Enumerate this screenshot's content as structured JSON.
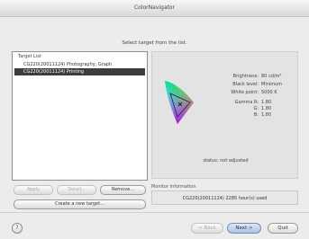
{
  "window": {
    "title": "ColorNavigator"
  },
  "instruction": "Select target from the list.",
  "targets": {
    "header": "Target List",
    "items": [
      "CG220(20011124) Photography, Graph",
      "CG220(20011124) Printing"
    ],
    "selected_index": 1,
    "buttons": {
      "apply": "Apply",
      "detail": "Detail...",
      "remove": "Remove...",
      "create": "Create a new target..."
    }
  },
  "target_info": {
    "brightness": {
      "label": "Brightness:",
      "value": "80 cd/m²"
    },
    "black_level": {
      "label": "Black level:",
      "value": "Minimum"
    },
    "white_point": {
      "label": "White point:",
      "value": "5000 K"
    },
    "gamma": {
      "label": "Gamma R:",
      "r": "1.80",
      "g_label": "G:",
      "g": "1.80",
      "b_label": "B:",
      "b": "1.80"
    },
    "status": "status: not adjusted"
  },
  "monitor": {
    "label": "Monitor Information",
    "value": "CG220(20011124) 2285 hour(s) used"
  },
  "footer": {
    "help": "?",
    "back": "< Back",
    "next": "Next >",
    "quit": "Quit"
  }
}
